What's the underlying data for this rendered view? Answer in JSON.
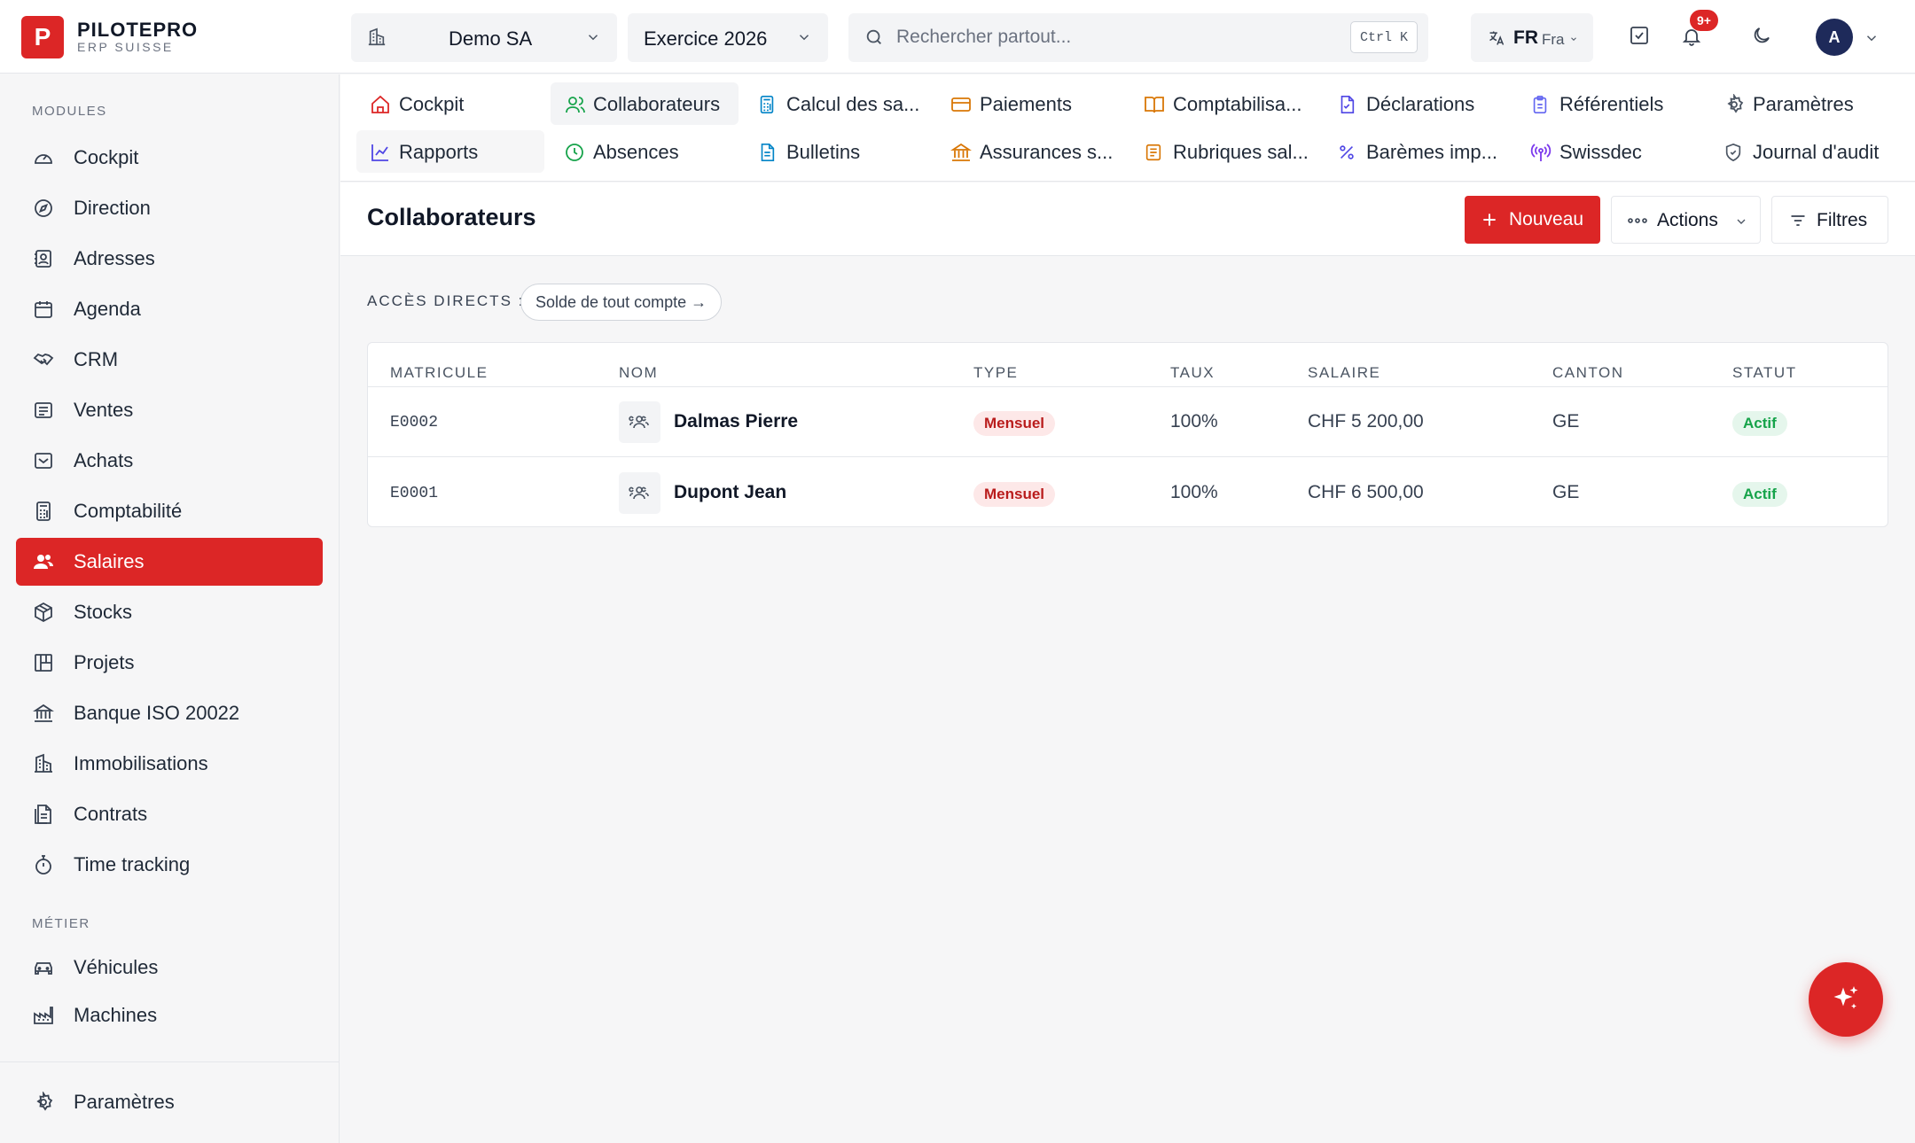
{
  "brand": {
    "name": "PILOTEPRO",
    "subtitle": "ERP SUISSE",
    "mark": "P"
  },
  "topbar": {
    "company": "Demo SA",
    "fiscal_year": "Exercice 2026",
    "search_placeholder": "Rechercher partout...",
    "search_shortcut": "Ctrl K",
    "language_code": "FR",
    "language_name": "Fra",
    "notification_count": "9+",
    "avatar_initial": "A"
  },
  "sidebar": {
    "section_modules": "MODULES",
    "section_metier": "MÉTIER",
    "items": [
      {
        "label": "Cockpit",
        "icon": "gauge-icon"
      },
      {
        "label": "Direction",
        "icon": "compass-icon"
      },
      {
        "label": "Adresses",
        "icon": "contact-icon"
      },
      {
        "label": "Agenda",
        "icon": "calendar-icon"
      },
      {
        "label": "CRM",
        "icon": "handshake-icon"
      },
      {
        "label": "Ventes",
        "icon": "receipt-icon"
      },
      {
        "label": "Achats",
        "icon": "inbox-icon"
      },
      {
        "label": "Comptabilité",
        "icon": "calculator-icon"
      },
      {
        "label": "Salaires",
        "icon": "users-icon",
        "active": true
      },
      {
        "label": "Stocks",
        "icon": "package-icon"
      },
      {
        "label": "Projets",
        "icon": "kanban-icon"
      },
      {
        "label": "Banque ISO 20022",
        "icon": "bank-icon"
      },
      {
        "label": "Immobilisations",
        "icon": "building-icon"
      },
      {
        "label": "Contrats",
        "icon": "document-icon"
      },
      {
        "label": "Time tracking",
        "icon": "stopwatch-icon"
      }
    ],
    "metier_items": [
      {
        "label": "Véhicules",
        "icon": "car-icon"
      },
      {
        "label": "Machines",
        "icon": "factory-icon"
      }
    ],
    "settings_label": "Paramètres"
  },
  "module_tabs": [
    {
      "label": "Cockpit",
      "icon": "home-icon",
      "color": "#dc2626"
    },
    {
      "label": "Collaborateurs",
      "icon": "users-icon",
      "color": "#16a34a",
      "active": true
    },
    {
      "label": "Calcul des sa...",
      "icon": "calculator-icon",
      "color": "#0284c7"
    },
    {
      "label": "Paiements",
      "icon": "credit-card-icon",
      "color": "#d97706"
    },
    {
      "label": "Comptabilisa...",
      "icon": "book-icon",
      "color": "#d97706"
    },
    {
      "label": "Déclarations",
      "icon": "file-check-icon",
      "color": "#4f46e5"
    },
    {
      "label": "Référentiels",
      "icon": "clipboard-icon",
      "color": "#6366f1"
    },
    {
      "label": "Paramètres",
      "icon": "gear-icon",
      "color": "#4b5563"
    },
    {
      "label": "Rapports",
      "icon": "line-chart-icon",
      "color": "#4f46e5"
    },
    {
      "label": "Absences",
      "icon": "clock-icon",
      "color": "#16a34a"
    },
    {
      "label": "Bulletins",
      "icon": "file-text-icon",
      "color": "#0284c7"
    },
    {
      "label": "Assurances s...",
      "icon": "bank-icon",
      "color": "#d97706"
    },
    {
      "label": "Rubriques sal...",
      "icon": "list-icon",
      "color": "#d97706"
    },
    {
      "label": "Barèmes imp...",
      "icon": "percent-icon",
      "color": "#4f46e5"
    },
    {
      "label": "Swissdec",
      "icon": "broadcast-icon",
      "color": "#7c3aed"
    },
    {
      "label": "Journal d'audit",
      "icon": "shield-icon",
      "color": "#4b5563"
    }
  ],
  "page": {
    "title": "Collaborateurs",
    "new_label": "Nouveau",
    "actions_label": "Actions",
    "filters_label": "Filtres",
    "quick_access_label": "ACCÈS DIRECTS :",
    "quick_access_link": "Solde de tout compte →"
  },
  "table": {
    "columns": [
      "MATRICULE",
      "NOM",
      "TYPE",
      "TAUX",
      "SALAIRE",
      "CANTON",
      "STATUT"
    ],
    "rows": [
      {
        "matricule": "E0002",
        "nom": "Dalmas Pierre",
        "type": "Mensuel",
        "taux": "100%",
        "salaire": "CHF 5 200,00",
        "canton": "GE",
        "statut": "Actif"
      },
      {
        "matricule": "E0001",
        "nom": "Dupont Jean",
        "type": "Mensuel",
        "taux": "100%",
        "salaire": "CHF 6 500,00",
        "canton": "GE",
        "statut": "Actif"
      }
    ]
  },
  "colors": {
    "accent": "#dc2626",
    "success": "#16a34a"
  }
}
